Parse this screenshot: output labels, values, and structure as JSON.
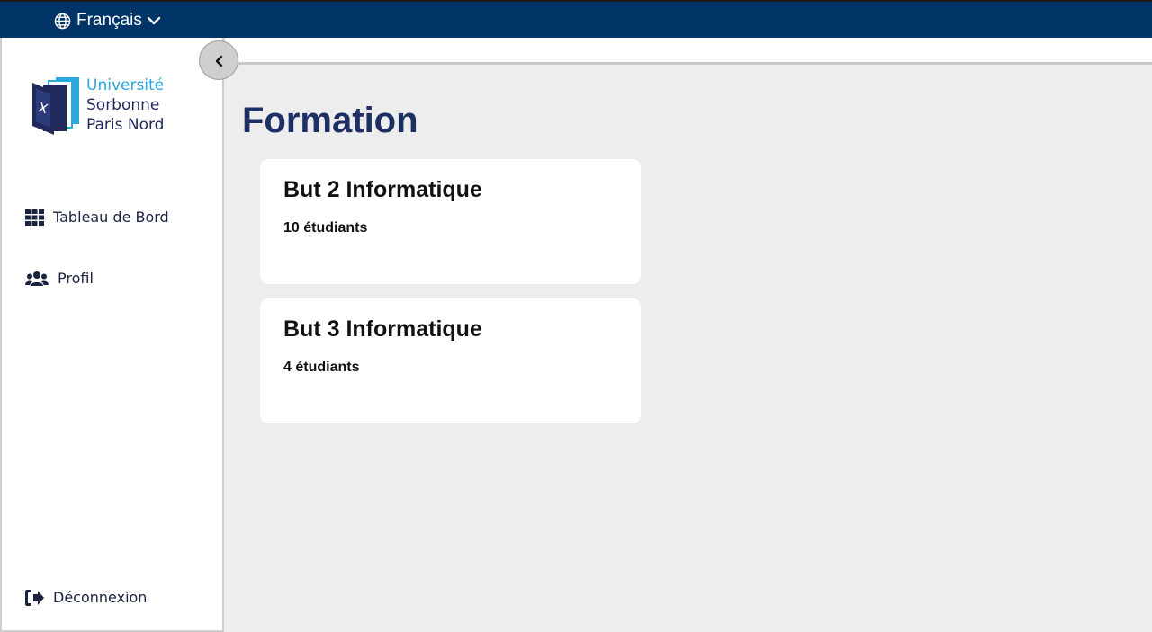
{
  "header": {
    "language": "Français",
    "language_icon": "globe-icon",
    "dropdown_icon": "chevron-down-icon"
  },
  "sidebar": {
    "logo": {
      "line1": "Université",
      "line2": "Sorbonne",
      "line3": "Paris Nord"
    },
    "items": [
      {
        "label": "Tableau de Bord",
        "icon": "grid-icon"
      },
      {
        "label": "Profil",
        "icon": "users-icon"
      }
    ],
    "logout": {
      "label": "Déconnexion",
      "icon": "sign-out-icon"
    },
    "collapse_icon": "chevron-left-icon"
  },
  "main": {
    "title": "Formation",
    "formations": [
      {
        "name": "But 2 Informatique",
        "count": "10 étudiants"
      },
      {
        "name": "But 3 Informatique",
        "count": "4 étudiants"
      }
    ]
  },
  "colors": {
    "topbar": "#003366",
    "title": "#1e2f63",
    "logo_accent": "#2aa9e0",
    "background": "#ededed"
  }
}
